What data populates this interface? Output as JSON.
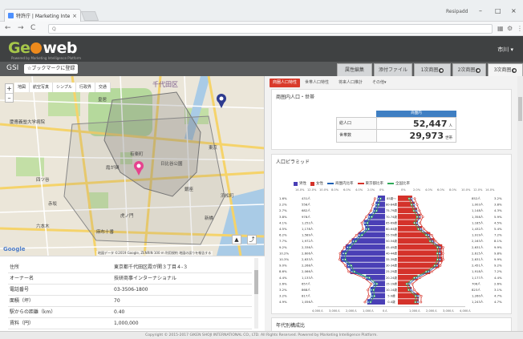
{
  "browser": {
    "tab_title": "特許庁 | Marketing Intelli",
    "tab_close": "×",
    "profile": "Resipadd",
    "minimize": "–",
    "maximize": "□",
    "close": "×",
    "back": "←",
    "forward": "→",
    "reload": "C",
    "url_text": "Q"
  },
  "app": {
    "logo_geo": "Ge",
    "logo_web": "web",
    "logo_tagline": "Powered by Marketing Intelligence Platform",
    "user_menu": "市川 ▾",
    "gsi": "GSI",
    "bookmark_label": "☆ブックマークに登録",
    "top_tabs": [
      {
        "label": "属性編集",
        "badge": ""
      },
      {
        "label": "添付ファイル",
        "badge": ""
      },
      {
        "label": "1次商圏",
        "badge": "●"
      },
      {
        "label": "2次商圏",
        "badge": "●"
      },
      {
        "label": "3次商圏",
        "badge": "●"
      }
    ]
  },
  "map": {
    "controls": [
      "地図",
      "航空写真",
      "シンプル",
      "行政界",
      "交通"
    ],
    "zoom_in": "+",
    "zoom_out": "–",
    "google": "Google",
    "credit": "地図データ ©2019 Google, ZENRIN  100 m  利用規約  地図の誤りを報告する",
    "labels": [
      {
        "text": "千代田区",
        "big": true
      },
      {
        "text": "皇居"
      },
      {
        "text": "日比谷公園"
      },
      {
        "text": "有楽町"
      },
      {
        "text": "霞が関"
      },
      {
        "text": "東京"
      },
      {
        "text": "銀座"
      },
      {
        "text": "新橋"
      },
      {
        "text": "赤坂"
      },
      {
        "text": "六本木"
      },
      {
        "text": "虎ノ門"
      },
      {
        "text": "浜松町"
      },
      {
        "text": "麻布十番"
      },
      {
        "text": "慶應義塾大学病院"
      },
      {
        "text": "四ツ谷"
      }
    ]
  },
  "property": {
    "rows": [
      {
        "key": "住所",
        "value": "東京都千代田区霞が関３丁目４-３"
      },
      {
        "key": "オーナー名",
        "value": "技研商事インターナショナル"
      },
      {
        "key": "電話番号",
        "value": "03-3506-1800"
      },
      {
        "key": "面積（坪）",
        "value": "70"
      },
      {
        "key": "駅からの距離（km）",
        "value": "0.40"
      },
      {
        "key": "賃料（円）",
        "value": "1,000,000"
      }
    ]
  },
  "panel": {
    "sub_tabs": [
      "商圏人口特性",
      "世帯人口特性",
      "将来人口推計",
      "その他▾"
    ],
    "pop_title": "商圏内人口・世帯",
    "pop_head": "商圏内",
    "pop_rows": [
      {
        "label": "総人口",
        "value": "52,447",
        "unit": "人"
      },
      {
        "label": "世帯数",
        "value": "29,973",
        "unit": "世帯"
      }
    ],
    "pyramid_title": "人口ピラミッド",
    "age_title": "年代別構成比",
    "legend": [
      {
        "label": "男性",
        "color": "#4a3fb6"
      },
      {
        "label": "女性",
        "color": "#d4322a"
      },
      {
        "label": "商圏内比率",
        "color": "#1f5fb4"
      },
      {
        "label": "東京都比率",
        "color": "#d4322a"
      },
      {
        "label": "全国比率",
        "color": "#2eaa58"
      }
    ]
  },
  "chart_data": {
    "type": "bar",
    "categories": [
      "85歳～",
      "80-84歳",
      "75-79歳",
      "70-74歳",
      "65-69歳",
      "60-64歳",
      "55-59歳",
      "50-54歳",
      "45-49歳",
      "40-44歳",
      "35-39歳",
      "30-34歳",
      "25-29歳",
      "20-24歳",
      "15-19歳",
      "10-14歳",
      "5-9歳",
      "0-4歳"
    ],
    "series": [
      {
        "name": "男性",
        "values": [
          431,
          558,
          682,
          978,
          1252,
          1178,
          1589,
          1972,
          2336,
          2606,
          2633,
          2268,
          2066,
          1133,
          657,
          868,
          817,
          1056
        ]
      },
      {
        "name": "女性",
        "values": [
          852,
          1003,
          1148,
          1358,
          1185,
          1432,
          1919,
          2163,
          2631,
          2615,
          2631,
          2451,
          1918,
          1177,
          706,
          823,
          1260,
          1243
        ]
      }
    ],
    "male_pct": [
      "1.6%",
      "2.2%",
      "2.7%",
      "3.8%",
      "4.1%",
      "4.5%",
      "6.2%",
      "7.7%",
      "9.2%",
      "10.2%",
      "10.3%",
      "9.0%",
      "8.6%",
      "4.4%",
      "2.6%",
      "3.2%",
      "3.2%",
      "4.9%"
    ],
    "female_pct": [
      "3.2%",
      "3.8%",
      "4.3%",
      "5.9%",
      "4.5%",
      "5.4%",
      "7.2%",
      "8.1%",
      "9.9%",
      "9.8%",
      "9.9%",
      "9.2%",
      "7.2%",
      "4.4%",
      "2.6%",
      "3.1%",
      "4.7%",
      "4.7%"
    ],
    "rate_axis_top": [
      "0%",
      "2.0%",
      "4.0%",
      "6.0%",
      "8.0%",
      "10.0%",
      "12.0%",
      "14.0%"
    ],
    "xticks": [
      "4,000人",
      "3,000人",
      "2,000人",
      "1,000人",
      "0人",
      "1,000人",
      "2,000人",
      "3,000人",
      "4,000人"
    ],
    "xlim": [
      -4000,
      4000
    ]
  },
  "footer": "Copyright © 2015-2017 GIKEN SHOJI INTERNATIONAL CO., LTD. All Rights Reserved.  Powered by Marketing Intelligence Platform."
}
